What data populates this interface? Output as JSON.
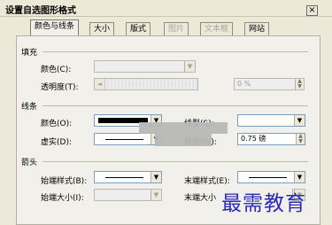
{
  "dialog": {
    "title": "设置自选图形格式",
    "close_label": "×"
  },
  "tabs": [
    {
      "label": "颜色与线条",
      "state": "active"
    },
    {
      "label": "大小",
      "state": "enabled"
    },
    {
      "label": "版式",
      "state": "enabled"
    },
    {
      "label": "图片",
      "state": "disabled"
    },
    {
      "label": "文本框",
      "state": "disabled"
    },
    {
      "label": "网站",
      "state": "enabled"
    }
  ],
  "fill": {
    "section_label": "填充",
    "color_label": "颜色(C):",
    "transparency_label": "透明度(T):",
    "transparency_value": "0 %"
  },
  "line": {
    "section_label": "线条",
    "color_label": "颜色(O):",
    "dash_label": "虚实(D):",
    "style_label": "线型(S):",
    "weight_label": "粗细(W):",
    "weight_value": "0.75 磅"
  },
  "arrows": {
    "section_label": "箭头",
    "begin_style_label": "始端样式(B):",
    "end_style_label": "末端样式(E):",
    "begin_size_label": "始端大小(I):",
    "end_size_label": "末端大小"
  },
  "watermark": "最需教育",
  "colors": {
    "dialog_bg": "#ece9d8",
    "panel_bg": "#f2f0ea",
    "field_border": "#7f9db9",
    "watermark": "#2a2ab7"
  }
}
